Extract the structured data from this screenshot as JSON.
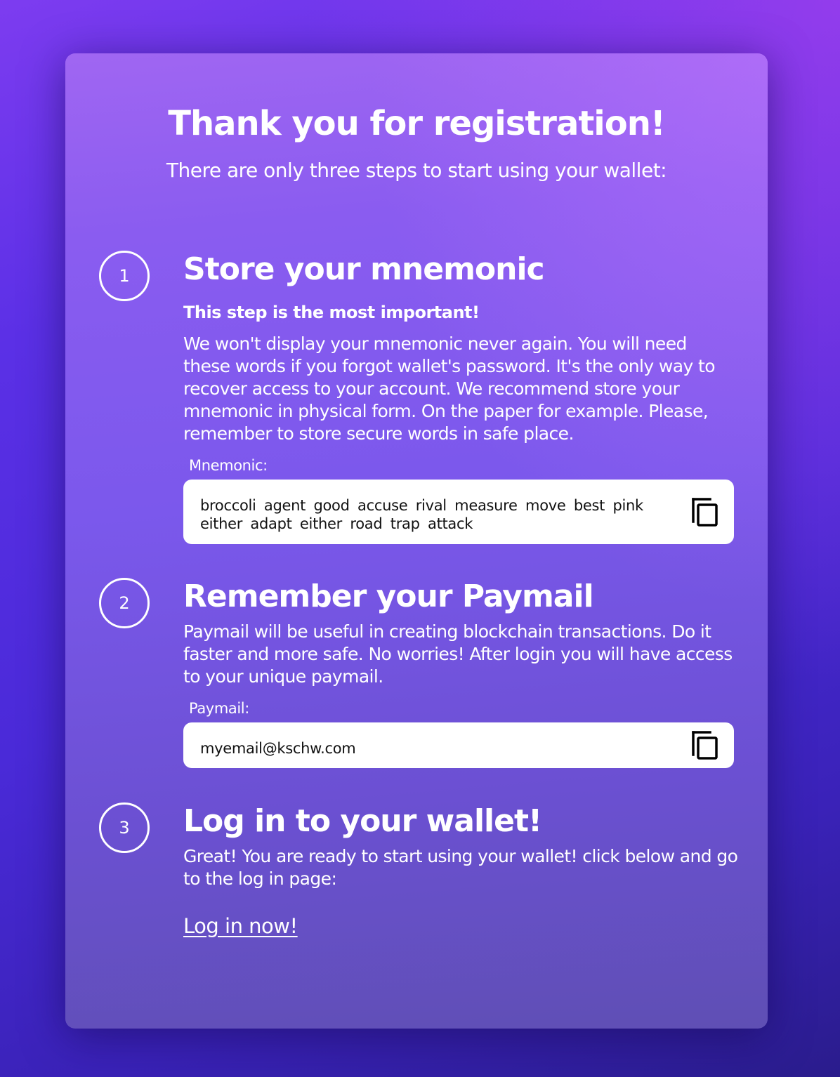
{
  "header": {
    "title": "Thank you for registration!",
    "subtitle": "There are only three steps to start using your wallet:"
  },
  "steps": [
    {
      "number": "1",
      "title": "Store your mnemonic",
      "emphasis": "This step is the most important!",
      "text": "We won't display your mnemonic never again. You will need these words if you forgot wallet's password. It's the only way to recover access to your account. We recommend store your mnemonic in physical form. On the paper for example. Please, remember to store secure words in safe place.",
      "field_label": "Mnemonic:",
      "field_value": "broccoli agent good accuse rival measure move best pink either adapt either road trap attack",
      "copy_icon": "copy-icon"
    },
    {
      "number": "2",
      "title": "Remember your Paymail",
      "text": "Paymail will be useful in creating blockchain transactions. Do it faster and more safe. No worries! After login you will have access to your unique paymail.",
      "field_label": "Paymail:",
      "field_value": "myemail@kschw.com",
      "copy_icon": "copy-icon"
    },
    {
      "number": "3",
      "title": "Log in to your wallet!",
      "text": "Great! You are ready to start using your wallet! click below and go to the log in page:",
      "link_label": "Log in now!"
    }
  ],
  "colors": {
    "card_top": "#a066f2",
    "card_bottom": "#5f4fb4",
    "background_top": "#7d3cf0",
    "background_bottom": "#2a1c8c",
    "text": "#ffffff",
    "field_background": "#ffffff"
  }
}
